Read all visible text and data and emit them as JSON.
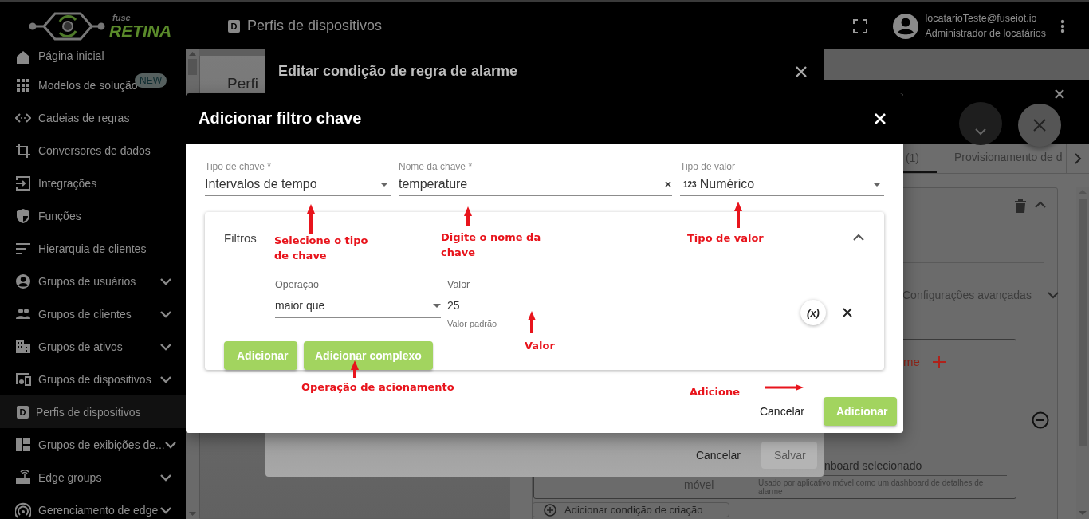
{
  "header": {
    "logo": {
      "small": "fuse",
      "big": "RETINA"
    },
    "page_icon": "D",
    "page_title": "Perfis de dispositivos",
    "user": {
      "email": "locatarioTeste@fuseiot.io",
      "role": "Administrador de locatários"
    }
  },
  "sidebar": {
    "items": [
      {
        "label": "Página inicial",
        "expandable": false,
        "selected": false
      },
      {
        "label": "Modelos de solução",
        "badge": "NEW",
        "expandable": false,
        "selected": false
      },
      {
        "label": "Cadeias de regras",
        "expandable": false,
        "selected": false
      },
      {
        "label": "Conversores de dados",
        "expandable": false,
        "selected": false
      },
      {
        "label": "Integrações",
        "expandable": false,
        "selected": false
      },
      {
        "label": "Funções",
        "expandable": false,
        "selected": false
      },
      {
        "label": "Hierarquia de clientes",
        "expandable": false,
        "selected": false
      },
      {
        "label": "Grupos de usuários",
        "expandable": true,
        "selected": false
      },
      {
        "label": "Grupos de clientes",
        "expandable": true,
        "selected": false
      },
      {
        "label": "Grupos de ativos",
        "expandable": true,
        "selected": false
      },
      {
        "label": "Grupos de dispositivos",
        "expandable": true,
        "selected": false
      },
      {
        "label": "Perfis de dispositivos",
        "icon_text": "D",
        "expandable": false,
        "selected": true
      },
      {
        "label": "Grupos de exibições de...",
        "expandable": true,
        "selected": false
      },
      {
        "label": "Edge groups",
        "expandable": true,
        "selected": false
      },
      {
        "label": "Gerenciamento de edge",
        "expandable": true,
        "selected": false
      }
    ]
  },
  "background": {
    "page_title": "Perfi",
    "rule_dialog": {
      "title": "Editar condição de regra de alarme",
      "buttons": [
        {
          "label": "Cancelar",
          "kind": "text",
          "disabled": false
        },
        {
          "label": "Salvar",
          "kind": "flat",
          "disabled": true
        }
      ]
    },
    "profile_panel": {
      "tabs": [
        {
          "label": "(1)",
          "selected": true
        },
        {
          "label": "Provisionamento de d",
          "selected": false
        }
      ],
      "advanced": {
        "label": "Configurações avançadas",
        "expanded": false
      },
      "alarm_label": "me",
      "side_label": "móvel",
      "dashboard_field": {
        "value": "nboard selecionado",
        "hint": "Usado por aplicativo móvel como um dashboard de detalhes de alarme"
      },
      "add_condition": "Adicionar condição de criação"
    }
  },
  "dialog": {
    "title": "Adicionar filtro chave",
    "fields": [
      {
        "kind": "select",
        "label": "Tipo de chave *",
        "value": "Intervalos de tempo"
      },
      {
        "kind": "text",
        "label": "Nome da chave *",
        "value": "temperature"
      },
      {
        "kind": "select",
        "label": "Tipo de valor",
        "prefix": "123",
        "value": "Numérico"
      }
    ],
    "filters": {
      "title": "Filtros",
      "expanded": true,
      "columns": [
        "Operação",
        "Valor"
      ],
      "rows": [
        {
          "operation": "maior que",
          "value": "25",
          "hint": "Valor padrão",
          "dynamic": "(x)"
        }
      ],
      "buttons": [
        "Adicionar",
        "Adicionar complexo"
      ]
    },
    "actions": [
      {
        "label": "Cancelar",
        "kind": "text"
      },
      {
        "label": "Adicionar",
        "kind": "raised"
      }
    ]
  },
  "annotations": [
    {
      "text": "Selecione o tipo de chave"
    },
    {
      "text": "Digite o nome da chave"
    },
    {
      "text": "Tipo de valor"
    },
    {
      "text": "Operação de acionamento"
    },
    {
      "text": "Valor"
    },
    {
      "text": "Adicione"
    }
  ]
}
